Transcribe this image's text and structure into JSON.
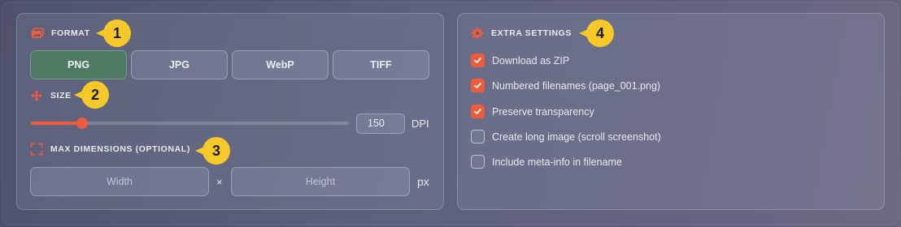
{
  "format": {
    "title": "FORMAT",
    "badge": "1",
    "options": [
      {
        "label": "PNG",
        "active": true
      },
      {
        "label": "JPG",
        "active": false
      },
      {
        "label": "WebP",
        "active": false
      },
      {
        "label": "TIFF",
        "active": false
      }
    ]
  },
  "size": {
    "title": "SIZE",
    "badge": "2",
    "dpi_value": "150",
    "dpi_unit": "DPI",
    "slider_fraction": 0.16
  },
  "max_dimensions": {
    "title": "MAX DIMENSIONS (OPTIONAL)",
    "badge": "3",
    "width_placeholder": "Width",
    "height_placeholder": "Height",
    "separator": "×",
    "unit": "px"
  },
  "extra_settings": {
    "title": "EXTRA SETTINGS",
    "badge": "4",
    "options": [
      {
        "label": "Download as ZIP",
        "checked": true
      },
      {
        "label": "Numbered filenames (page_001.png)",
        "checked": true
      },
      {
        "label": "Preserve transparency",
        "checked": true
      },
      {
        "label": "Create long image (scroll screenshot)",
        "checked": false
      },
      {
        "label": "Include meta-info in filename",
        "checked": false
      }
    ]
  },
  "colors": {
    "accent": "#ef5b3c",
    "active_button": "#4e7a64",
    "badge": "#f6c928"
  },
  "icons": {
    "format": "images-icon",
    "size": "move-arrows-icon",
    "max_dimensions": "expand-corners-icon",
    "extra_settings": "gear-icon",
    "checkbox": "checkmark-icon"
  }
}
